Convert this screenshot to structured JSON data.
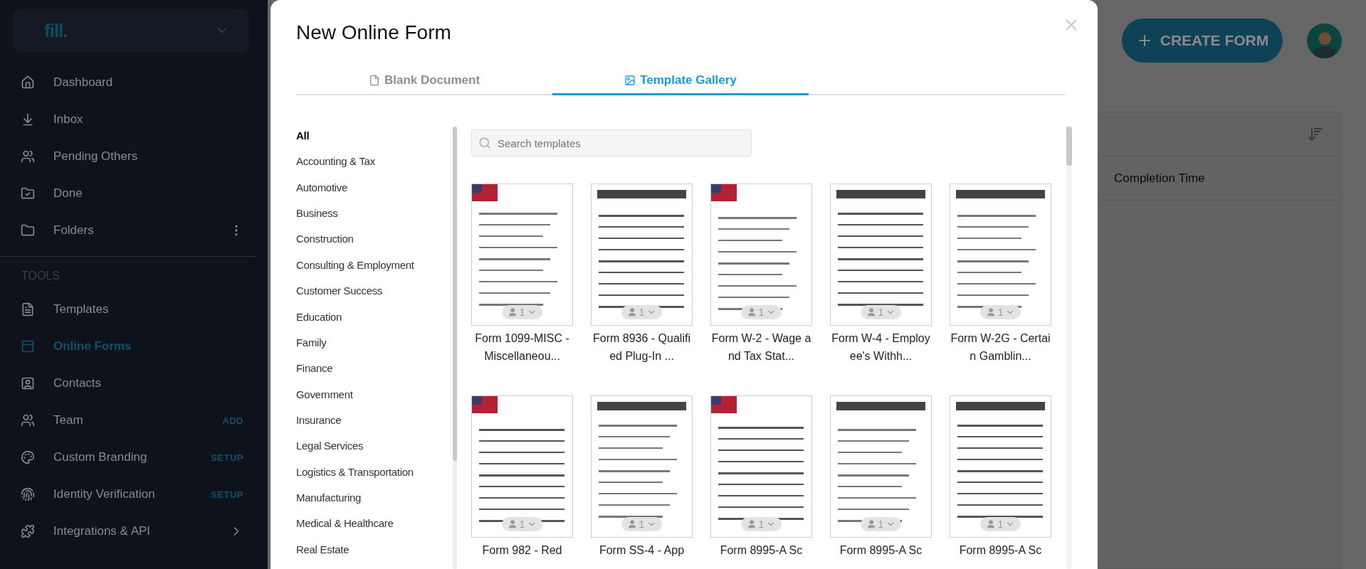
{
  "sidebar": {
    "logo": "fill.",
    "items": [
      {
        "label": "Dashboard",
        "selected": false,
        "kind": "plain"
      },
      {
        "label": "Inbox",
        "selected": false,
        "kind": "plain"
      },
      {
        "label": "Pending Others",
        "selected": false,
        "kind": "plain"
      },
      {
        "label": "Done",
        "selected": false,
        "kind": "plain"
      },
      {
        "label": "Folders",
        "selected": false,
        "kind": "options"
      }
    ],
    "tools_heading": "TOOLS",
    "tools": [
      {
        "label": "Templates",
        "selected": false,
        "kind": "plain"
      },
      {
        "label": "Online Forms",
        "selected": true,
        "kind": "plain"
      },
      {
        "label": "Contacts",
        "selected": false,
        "kind": "plain"
      },
      {
        "label": "Team",
        "selected": false,
        "kind": "action",
        "action": "ADD"
      },
      {
        "label": "Custom Branding",
        "selected": false,
        "kind": "action",
        "action": "SETUP"
      },
      {
        "label": "Identity Verification",
        "selected": false,
        "kind": "action",
        "action": "SETUP"
      },
      {
        "label": "Integrations & API",
        "selected": false,
        "kind": "expandable"
      }
    ]
  },
  "header": {
    "create_button": "CREATE FORM"
  },
  "table": {
    "columns": [
      "Completion Time"
    ]
  },
  "modal": {
    "title": "New Online Form",
    "tabs": [
      {
        "label": "Blank Document",
        "selected": false
      },
      {
        "label": "Template Gallery",
        "selected": true
      }
    ],
    "categories": [
      {
        "label": "All",
        "selected": true
      },
      {
        "label": "Accounting & Tax",
        "selected": false
      },
      {
        "label": "Automotive",
        "selected": false
      },
      {
        "label": "Business",
        "selected": false
      },
      {
        "label": "Construction",
        "selected": false
      },
      {
        "label": "Consulting & Employment",
        "selected": false
      },
      {
        "label": "Customer Success",
        "selected": false
      },
      {
        "label": "Education",
        "selected": false
      },
      {
        "label": "Family",
        "selected": false
      },
      {
        "label": "Finance",
        "selected": false
      },
      {
        "label": "Government",
        "selected": false
      },
      {
        "label": "Insurance",
        "selected": false
      },
      {
        "label": "Legal Services",
        "selected": false
      },
      {
        "label": "Logistics & Transportation",
        "selected": false
      },
      {
        "label": "Manufacturing",
        "selected": false
      },
      {
        "label": "Medical & Healthcare",
        "selected": false
      },
      {
        "label": "Real Estate",
        "selected": false
      }
    ],
    "search": {
      "placeholder": "Search templates"
    },
    "templates": [
      {
        "title": "Form 1099-MISC - Miscellaneou...",
        "signers": "1"
      },
      {
        "title": "Form 8936 - Qualified Plug-In ...",
        "signers": "1"
      },
      {
        "title": "Form W-2 - Wage and Tax Stat...",
        "signers": "1"
      },
      {
        "title": "Form W-4 - Employee's Withh...",
        "signers": "1"
      },
      {
        "title": "Form W-2G - Certain Gamblin...",
        "signers": "1"
      },
      {
        "title": "Form 982 - Red",
        "signers": "1"
      },
      {
        "title": "Form SS-4 - App",
        "signers": "1"
      },
      {
        "title": "Form 8995-A Sc",
        "signers": "1"
      },
      {
        "title": "Form 8995-A Sc",
        "signers": "1"
      },
      {
        "title": "Form 8995-A Sc",
        "signers": "1"
      }
    ]
  }
}
